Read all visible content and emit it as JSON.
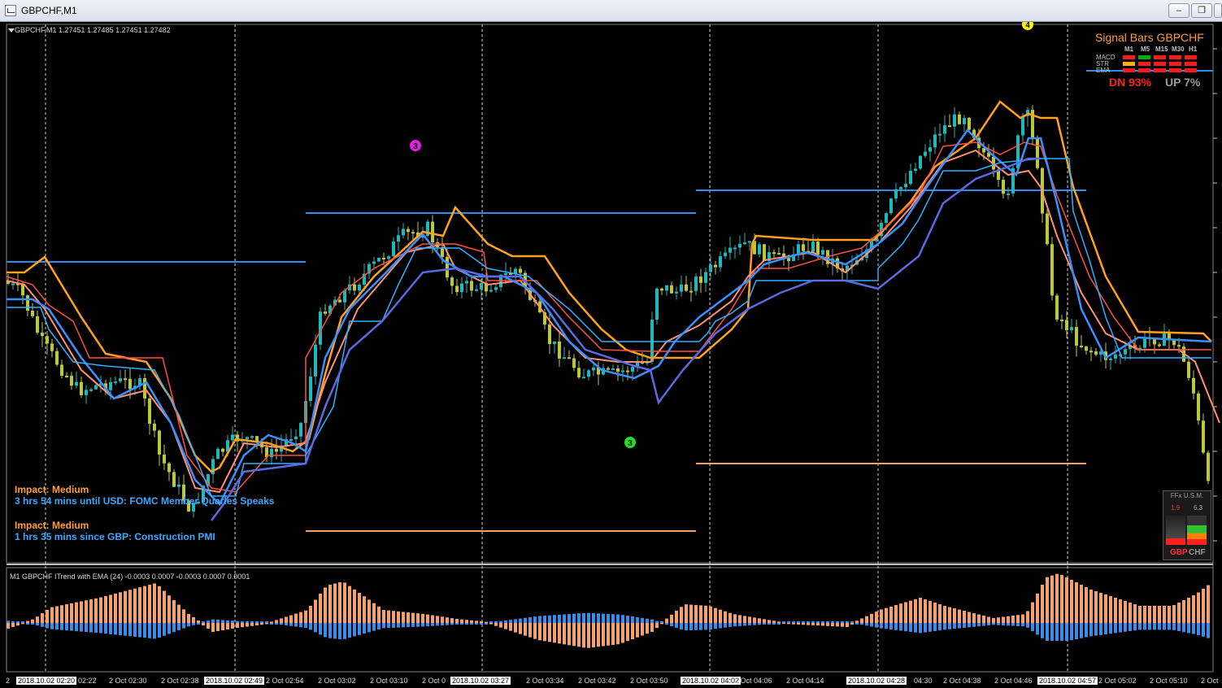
{
  "window": {
    "title": "GBPCHF,M1",
    "buttons": {
      "minimize": "–",
      "restore": "❐",
      "close": "✕"
    }
  },
  "chart": {
    "header": "GBPCHF,M1  1.27451 1.27485 1.27451 1.27482",
    "colors": {
      "background": "#000000",
      "bull_candle": "#20b8b8",
      "bear_candle": "#b8c840",
      "ema_orange": "#ffa020",
      "ema_salmon": "#ff9070",
      "ema_red": "#ff5040",
      "ema_blue": "#3a90ff",
      "ema_lightblue": "#30b0ff",
      "ema_navy": "#5a6ae0",
      "level_line_blue": "#2f8cf0",
      "level_line_orange": "#f0a060"
    },
    "markers": [
      {
        "name": "marker-3-magenta",
        "label": "3",
        "color": "#e020e0"
      },
      {
        "name": "marker-3-green",
        "label": "3",
        "color": "#20e020"
      },
      {
        "name": "marker-4-yellow",
        "label": "4",
        "color": "#ffff00"
      }
    ]
  },
  "news": {
    "item1_impact": "Impact: Medium",
    "item1_text": "3 hrs 54 mins until USD: FOMC Member Quarles Speaks",
    "item2_impact": "Impact: Medium",
    "item2_text": "1 hrs 35 mins since GBP: Construction PMI"
  },
  "signal_panel": {
    "title": "Signal Bars GBPCHF",
    "timeframes": [
      "M1",
      "M5",
      "M15",
      "M30",
      "H1"
    ],
    "rows": [
      {
        "label": "MACD",
        "cells": [
          "#ff1a1a",
          "#00b000",
          "#ff1a1a",
          "#ff1a1a",
          "#ff1a1a"
        ]
      },
      {
        "label": "STR",
        "cells": [
          "#ffb000",
          "#ff1a1a",
          "#ff1a1a",
          "#ff1a1a",
          "#ff1a1a"
        ]
      },
      {
        "label": "EMA",
        "cells": [
          "#ff1a1a",
          "#ff1a1a",
          "#ff1a1a",
          "#ff1a1a",
          "#ff1a1a"
        ]
      }
    ],
    "dn": "DN 93%",
    "up": "UP 7%"
  },
  "ffx_widget": {
    "header": "FFx U.S.M.",
    "left_value": "1.9",
    "right_value": "6.3",
    "left_currency": "GBP",
    "right_currency": "CHF"
  },
  "oscillator": {
    "label": "M1 GBPCHF ITrend with EMA (24) -0.0003 0.0007 -0.0003 0.0007 0.0001",
    "colors": {
      "positive": "#f4a070",
      "negative": "#3a8ce8"
    }
  },
  "time_axis": [
    {
      "text": "2",
      "boxed": false
    },
    {
      "text": "2018.10.02 02:20",
      "boxed": true
    },
    {
      "text": "02:22",
      "boxed": false
    },
    {
      "text": "2 Oct 02:30",
      "boxed": false
    },
    {
      "text": "2 Oct 02:38",
      "boxed": false
    },
    {
      "text": "2018.10.02 02:49",
      "boxed": true
    },
    {
      "text": "2 Oct 02:54",
      "boxed": false
    },
    {
      "text": "2 Oct 03:02",
      "boxed": false
    },
    {
      "text": "2 Oct 03:10",
      "boxed": false
    },
    {
      "text": "2 Oct 0",
      "boxed": false
    },
    {
      "text": "2018.10.02 03:27",
      "boxed": true
    },
    {
      "text": "2 Oct 03:34",
      "boxed": false
    },
    {
      "text": "2 Oct 03:42",
      "boxed": false
    },
    {
      "text": "2 Oct 03:50",
      "boxed": false
    },
    {
      "text": "2018.10.02 04:02",
      "boxed": true
    },
    {
      "text": "2 Oct 04:06",
      "boxed": false
    },
    {
      "text": "2 Oct 04:14",
      "boxed": false
    },
    {
      "text": "2018.10.02 04:28",
      "boxed": true
    },
    {
      "text": "04:30",
      "boxed": false
    },
    {
      "text": "2 Oct 04:38",
      "boxed": false
    },
    {
      "text": "2 Oct 04:46",
      "boxed": false
    },
    {
      "text": "2018.10.02 04:57",
      "boxed": true
    },
    {
      "text": "2 Oct 05:02",
      "boxed": false
    },
    {
      "text": "2 Oct 05:10",
      "boxed": false
    },
    {
      "text": "2 Oct",
      "boxed": false
    }
  ]
}
